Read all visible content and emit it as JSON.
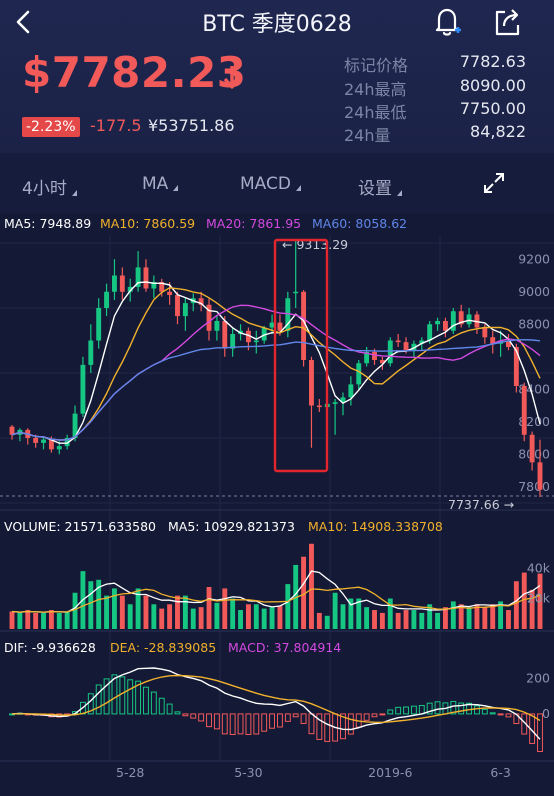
{
  "nav": {
    "title": "BTC 季度0628"
  },
  "ticker": {
    "price": "$7782.23",
    "change_pct": "-2.23%",
    "change_abs": "-177.5",
    "price_cny": "¥53751.86"
  },
  "stats": [
    {
      "label": "标记价格",
      "value": "7782.63"
    },
    {
      "label": "24h最高",
      "value": "8090.00"
    },
    {
      "label": "24h最低",
      "value": "7750.00"
    },
    {
      "label": "24h量",
      "value": "84,822"
    }
  ],
  "tabs": {
    "interval": "4小时",
    "ma": "MA",
    "indicator": "MACD",
    "settings": "设置"
  },
  "legends": {
    "ma5": "MA5: 7948.89",
    "ma10": "MA10: 7860.59",
    "ma20": "MA20: 7861.95",
    "ma60": "MA60: 8058.62",
    "volume": "VOLUME: 21571.633580",
    "vol_ma5": "MA5: 10929.821373",
    "vol_ma10": "MA10: 14908.338708",
    "dif": "DIF: -9.936628",
    "dea": "DEA: -28.839085",
    "macd": "MACD: 37.804914"
  },
  "annotations": {
    "high": "← 9313.29",
    "low": "7737.66 →"
  },
  "y_ticks_price": [
    "9200",
    "9000",
    "8800",
    "8400",
    "8200",
    "8000",
    "7800"
  ],
  "y_ticks_volume": [
    "40k",
    "20k"
  ],
  "y_ticks_macd": [
    "200",
    "0"
  ],
  "x_ticks": [
    "5-28",
    "5-30",
    "2019-6",
    "6-3"
  ],
  "colors": {
    "up": "#16c784",
    "down": "#f25a5a",
    "ma5": "#ffffff",
    "ma10": "#f0b12c",
    "ma20": "#d34ae0",
    "ma60": "#5f86e8",
    "highlight": "#e3262e"
  },
  "chart_data": {
    "type": "candlestick",
    "interval": "4小时",
    "ylim": [
      7700,
      9300
    ],
    "candles": [
      [
        8170,
        8180,
        8090,
        8120
      ],
      [
        8120,
        8160,
        8080,
        8150
      ],
      [
        8150,
        8160,
        8060,
        8100
      ],
      [
        8100,
        8120,
        8040,
        8070
      ],
      [
        8070,
        8110,
        8030,
        8090
      ],
      [
        8090,
        8110,
        8010,
        8030
      ],
      [
        8030,
        8080,
        8000,
        8050
      ],
      [
        8050,
        8120,
        8030,
        8100
      ],
      [
        8100,
        8300,
        8080,
        8250
      ],
      [
        8250,
        8600,
        8230,
        8550
      ],
      [
        8550,
        8800,
        8500,
        8700
      ],
      [
        8700,
        8960,
        8650,
        8900
      ],
      [
        8900,
        9050,
        8850,
        9000
      ],
      [
        9000,
        9200,
        8950,
        9100
      ],
      [
        9100,
        9150,
        8950,
        9000
      ],
      [
        9000,
        9080,
        8940,
        9030
      ],
      [
        9030,
        9250,
        9000,
        9150
      ],
      [
        9150,
        9200,
        9000,
        9020
      ],
      [
        9020,
        9100,
        8960,
        9060
      ],
      [
        9060,
        9080,
        8970,
        9000
      ],
      [
        9000,
        9060,
        8920,
        8980
      ],
      [
        8980,
        9000,
        8800,
        8850
      ],
      [
        8850,
        8960,
        8760,
        8930
      ],
      [
        8930,
        8990,
        8880,
        8960
      ],
      [
        8960,
        9000,
        8880,
        8920
      ],
      [
        8920,
        8960,
        8700,
        8760
      ],
      [
        8760,
        8850,
        8700,
        8820
      ],
      [
        8820,
        8850,
        8600,
        8650
      ],
      [
        8650,
        8780,
        8600,
        8740
      ],
      [
        8740,
        8800,
        8700,
        8760
      ],
      [
        8760,
        8780,
        8640,
        8690
      ],
      [
        8690,
        8760,
        8620,
        8700
      ],
      [
        8700,
        8790,
        8680,
        8780
      ],
      [
        8780,
        8860,
        8740,
        8810
      ],
      [
        8810,
        8860,
        8730,
        8760
      ],
      [
        8760,
        9000,
        8720,
        8960
      ],
      [
        9000,
        9313,
        8900,
        9000
      ],
      [
        9000,
        9010,
        8540,
        8580
      ],
      [
        8580,
        8600,
        8040,
        8300
      ],
      [
        8300,
        8340,
        8260,
        8290
      ],
      [
        8290,
        8330,
        8270,
        8310
      ],
      [
        8310,
        8340,
        8120,
        8320
      ],
      [
        8320,
        8380,
        8240,
        8350
      ],
      [
        8350,
        8480,
        8300,
        8430
      ],
      [
        8430,
        8580,
        8400,
        8560
      ],
      [
        8560,
        8660,
        8540,
        8630
      ],
      [
        8630,
        8650,
        8550,
        8580
      ],
      [
        8580,
        8600,
        8520,
        8560
      ],
      [
        8560,
        8720,
        8540,
        8700
      ],
      [
        8700,
        8740,
        8660,
        8690
      ],
      [
        8690,
        8720,
        8620,
        8640
      ],
      [
        8640,
        8700,
        8600,
        8680
      ],
      [
        8680,
        8720,
        8640,
        8700
      ],
      [
        8700,
        8820,
        8680,
        8800
      ],
      [
        8800,
        8840,
        8760,
        8820
      ],
      [
        8820,
        8840,
        8720,
        8760
      ],
      [
        8760,
        8900,
        8740,
        8880
      ],
      [
        8880,
        8920,
        8780,
        8800
      ],
      [
        8800,
        8900,
        8780,
        8860
      ],
      [
        8860,
        8880,
        8740,
        8780
      ],
      [
        8780,
        8800,
        8680,
        8720
      ],
      [
        8720,
        8760,
        8620,
        8680
      ],
      [
        8680,
        8760,
        8600,
        8700
      ],
      [
        8700,
        8740,
        8640,
        8660
      ],
      [
        8660,
        8680,
        8380,
        8420
      ],
      [
        8420,
        8440,
        8080,
        8120
      ],
      [
        8120,
        8140,
        7900,
        7950
      ],
      [
        7950,
        8090,
        7737,
        7782
      ]
    ],
    "volume_ylim": [
      0,
      60000
    ],
    "macd_ylim": [
      -250,
      300
    ]
  }
}
